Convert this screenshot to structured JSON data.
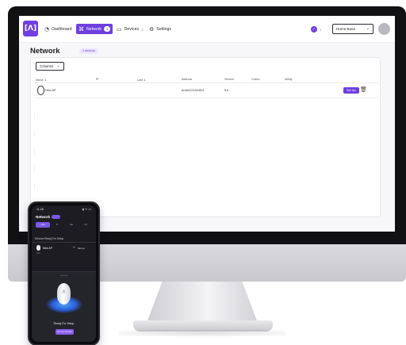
{
  "app": {
    "logo_text": "[Λ]",
    "brand_color": "#6f3fe0"
  },
  "nav": {
    "dashboard": {
      "label": "Dashboard",
      "icon": "dashboard-icon"
    },
    "network": {
      "label": "Network",
      "count": "1",
      "icon": "network-icon"
    },
    "devices": {
      "label": "Devices",
      "count": "1",
      "icon": "devices-icon"
    },
    "settings": {
      "label": "Settings",
      "icon": "gear-icon"
    }
  },
  "header": {
    "notification_count": "1",
    "site_selector": "Home Base",
    "avatar": "user-avatar"
  },
  "page": {
    "title": "Network",
    "badge": "1 devices"
  },
  "table": {
    "columns_button": "Columns",
    "headers": [
      "Name",
      "IP",
      "Last",
      "Address",
      "Version",
      "Colors",
      "Ability"
    ],
    "rows": [
      {
        "name": "New AP",
        "ip": "",
        "last": "",
        "address": "6c4d0221524f24",
        "version": "5.0",
        "colors": "· · · · ·",
        "setup_label": "Set Up"
      }
    ]
  },
  "phone": {
    "time": "11:28",
    "signal": "▮ ᯤ ▭",
    "title": "Network",
    "tabs": [
      "List",
      "Tt",
      "Aa",
      "Ot"
    ],
    "section": "Devices Ready For Setup",
    "device": {
      "name": "New AP",
      "sub": "AP1",
      "action": "Set up",
      "plus": "+"
    },
    "ready_text": "Ready For Setup",
    "cta": "Set up Device"
  }
}
